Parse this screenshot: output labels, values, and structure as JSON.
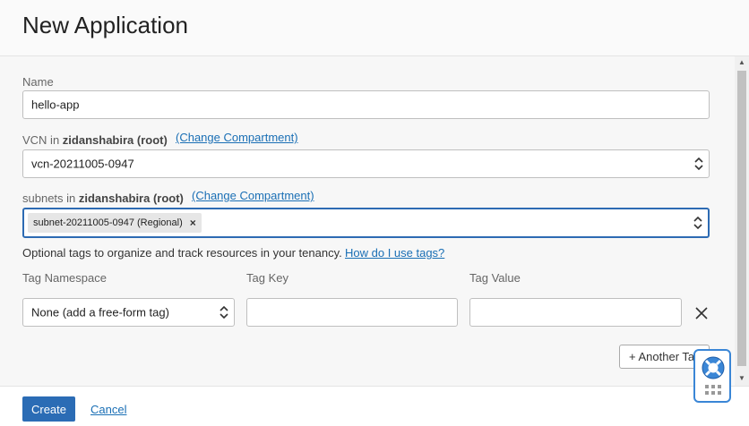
{
  "header": {
    "title": "New Application"
  },
  "form": {
    "name": {
      "label": "Name",
      "value": "hello-app"
    },
    "vcn": {
      "label_prefix": "VCN in ",
      "compartment": "zidanshabira (root)",
      "change_link": "(Change Compartment)",
      "value": "vcn-20211005-0947"
    },
    "subnets": {
      "label_prefix": "subnets in ",
      "compartment": "zidanshabira (root)",
      "change_link": "(Change Compartment)",
      "chip": "subnet-20211005-0947 (Regional)",
      "chip_remove": "×"
    },
    "tags": {
      "description": "Optional tags to organize and track resources in your tenancy.",
      "help_link": "How do I use tags?",
      "namespace_header": "Tag Namespace",
      "key_header": "Tag Key",
      "value_header": "Tag Value",
      "namespace_value": "None (add a free-form tag)",
      "key_value": "",
      "value_value": "",
      "another_tag": "+ Another Tag"
    }
  },
  "footer": {
    "create": "Create",
    "cancel": "Cancel"
  },
  "colors": {
    "primary": "#2b6cb5",
    "link": "#1a6fb5",
    "focus": "#2d6bb3"
  },
  "icons": {
    "remove_row": "close-icon",
    "help": "lifebuoy-icon"
  }
}
